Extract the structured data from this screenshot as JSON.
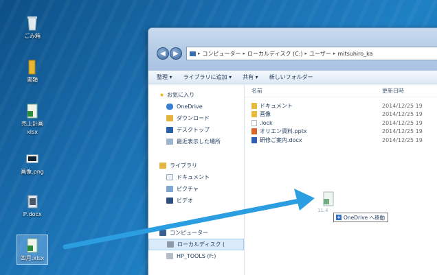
{
  "desktop": {
    "icons": [
      {
        "label": "ごみ箱",
        "icon": "recycle-bin-icon"
      },
      {
        "label": "書類",
        "icon": "folder-icon"
      },
      {
        "label": "売上計画",
        "label2": "xlsx",
        "icon": "excel-file-icon"
      },
      {
        "label": "画像.png",
        "icon": "image-file-icon"
      },
      {
        "label": "ℙ.docx",
        "icon": "word-file-icon"
      },
      {
        "label": "四月.xlsx",
        "icon": "excel-file-icon"
      }
    ]
  },
  "window": {
    "address": {
      "segments": [
        "コンピューター",
        "ローカルディスク (C:)",
        "ユーザー",
        "mitsuhiro_ka"
      ]
    },
    "toolbar": {
      "organize": "整理 ▾",
      "include_library": "ライブラリに追加 ▾",
      "share": "共有 ▾",
      "new_folder": "新しいフォルダー"
    },
    "nav": {
      "favorites": "お気に入り",
      "onedrive": "OneDrive",
      "downloads": "ダウンロード",
      "desktop": "デスクトップ",
      "recent": "最近表示した場所",
      "libraries": "ライブラリ",
      "documents": "ドキュメント",
      "pictures": "ピクチャ",
      "videos": "ビデオ",
      "computer": "コンピューター",
      "local_disk": "ローカルディスク (",
      "hp_tools": "HP_TOOLS (F:)"
    },
    "columns": {
      "name": "名前",
      "date": "更新日時"
    },
    "files": [
      {
        "name": "ドキュメント",
        "date": "2014/12/25 19"
      },
      {
        "name": "画像",
        "date": "2014/12/25 19"
      },
      {
        "name": ".lock",
        "date": "2014/12/25 19"
      },
      {
        "name": "オリエン資料.pptx",
        "date": "2014/12/25 19"
      },
      {
        "name": "研修ご案内.docx",
        "date": "2014/12/25 19"
      }
    ]
  },
  "drag": {
    "tooltip": "OneDrive へ移動",
    "ghost_label": "11.4"
  },
  "colors": {
    "arrow": "#2a9ee0",
    "window_chrome": "#b5cce6"
  }
}
